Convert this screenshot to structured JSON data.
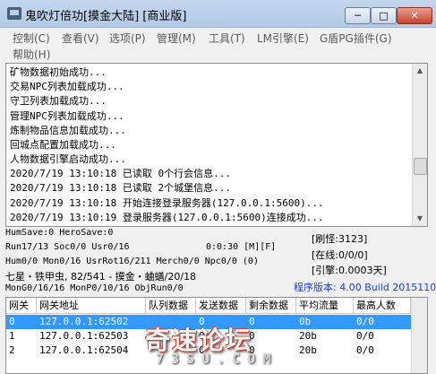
{
  "window": {
    "title": "鬼吹灯倍功[摸金大陆] [商业版]",
    "buttons": {
      "minimize": "─",
      "maximize": "□",
      "close": "✕"
    }
  },
  "menu": [
    "控制(C)",
    "查看(V)",
    "选项(P)",
    "管理(M)",
    "工具(T)",
    "LM引擎(E)",
    "G盾PG插件(G)",
    "帮助(H)"
  ],
  "log": {
    "lines": [
      "矿物数据初始成功...",
      "交易NPC列表加载成功...",
      "守卫列表加载成功...",
      "管理NPC列表加载成功...",
      "炼制物品信息加载成功...",
      "回城点配置加载成功...",
      "人物数据引擎启动成功...",
      "2020/7/19 13:10:18 已读取 0个行会信息...",
      "2020/7/19 13:10:18 已读取 2个城堡信息...",
      "2020/7/19 13:10:18 开始连接登录服务器(127.0.0.1:5600)...",
      "2020/7/19 13:10:19 登录服务器(127.0.0.1:5600)连接成功..."
    ]
  },
  "status": {
    "line1": "HumSave:0 HeroSave:0",
    "line2": "Run17/13 Soc0/0 Usr0/16",
    "line2b": "0:0:30 [M][F]",
    "line3": "Hum0/0 Mon0/16 UsrRot16/211 Merch0/0 Npc0/0 (0)",
    "line4": "七星・铁甲虫, 82/541 - 摸金・蛐蟮/20/18",
    "line5": "MonG0/16/16 MonP0/10/16 ObjRun0/0",
    "refresh": "[刷怪:3123]",
    "online": "[在线:0/0/0]",
    "engine": "[引擎:0.0003天]",
    "version": "程序版本: 4.00 Build 20151104"
  },
  "table": {
    "headers": [
      "网关",
      "网关地址",
      "队列数据",
      "发送数据",
      "剩余数据",
      "平均流量",
      "最高人数"
    ],
    "rows": [
      [
        "0",
        "127.0.0.1:62502",
        "",
        "0",
        "0",
        "0b",
        "0/0"
      ],
      [
        "1",
        "127.0.0.1:62503",
        "",
        "0",
        "0",
        "20b",
        "0/0"
      ],
      [
        "2",
        "127.0.0.1:62504",
        "",
        "0",
        "0",
        "20b",
        "0/0"
      ]
    ],
    "selected_row": 0,
    "selection_color": "#3399ff"
  },
  "watermark": {
    "main": "奇速论坛",
    "sub": "73SU.COM"
  }
}
